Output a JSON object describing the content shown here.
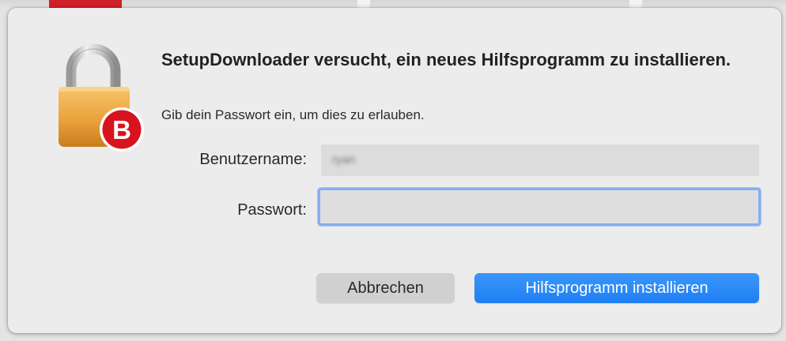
{
  "dialog": {
    "title": "SetupDownloader versucht, ein neues Hilfsprogramm zu installieren.",
    "subtitle": "Gib dein Passwort ein, um dies zu erlauben.",
    "icon": "lock-icon",
    "badge_letter": "B",
    "badge_color": "#d7141e",
    "username_label": "Benutzername:",
    "username_value": "ryan",
    "password_label": "Passwort:",
    "password_value": "",
    "cancel_label": "Abbrechen",
    "install_label": "Hilfsprogramm installieren",
    "accent_color": "#2a88f7"
  }
}
